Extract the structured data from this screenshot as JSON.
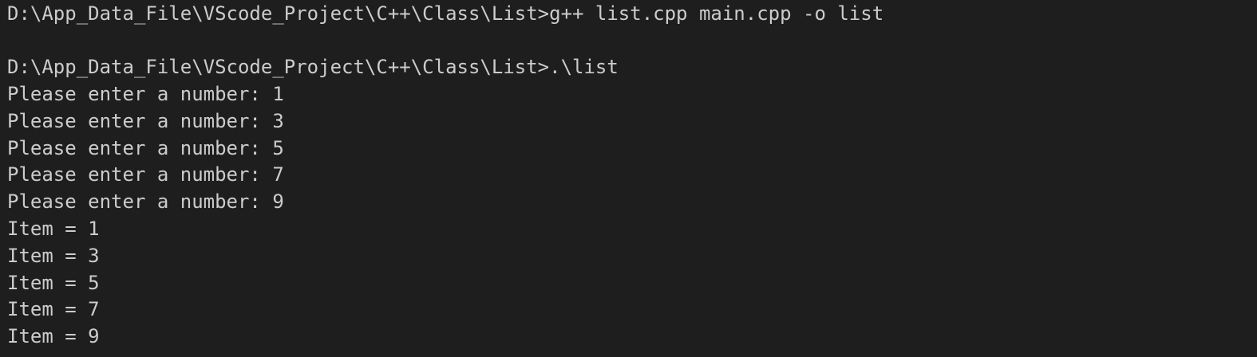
{
  "terminal": {
    "lines": [
      "D:\\App_Data_File\\VScode_Project\\C++\\Class\\List>g++ list.cpp main.cpp -o list",
      "",
      "D:\\App_Data_File\\VScode_Project\\C++\\Class\\List>.\\list",
      "Please enter a number: 1",
      "Please enter a number: 3",
      "Please enter a number: 5",
      "Please enter a number: 7",
      "Please enter a number: 9",
      "Item = 1",
      "Item = 3",
      "Item = 5",
      "Item = 7",
      "Item = 9"
    ]
  }
}
